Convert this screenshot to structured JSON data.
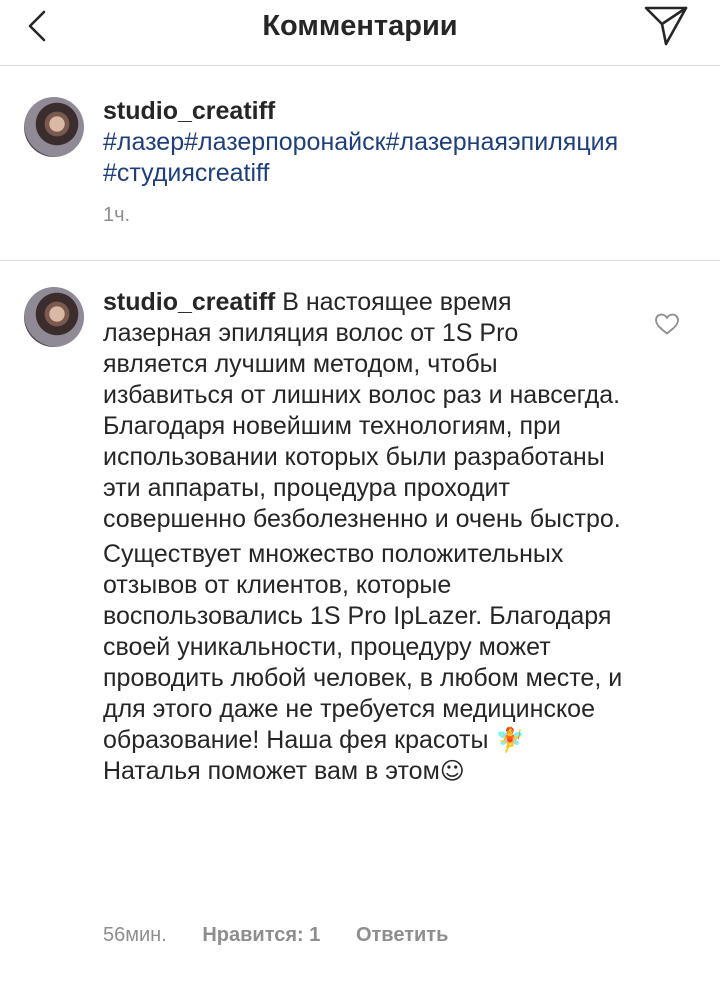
{
  "header": {
    "title": "Комментарии",
    "back_icon": "chevron-left-icon",
    "send_icon": "paper-plane-icon"
  },
  "caption": {
    "username": "studio_creatiff",
    "hashtags": [
      "#лазер",
      "#лазерпоронайск",
      "#лазернаяэпиляция",
      "#студияcreatiff"
    ],
    "time": "1ч."
  },
  "comment": {
    "username": "studio_creatiff",
    "paragraph1": "В настоящее время лазерная эпиляция волос от 1S Pro является лучшим методом, чтобы избавиться от лишних волос раз и навсегда. Благодаря новейшим технологиям, при использовании которых были разработаны эти аппараты, процедура проходит совершенно безболезненно и очень быстро.",
    "paragraph2_a": "Существует множество положительных отзывов от клиентов, которые воспользовались 1S Pro IpLazer. Благодаря своей уникальности, процедуру может проводить любой человек, в любом месте, и для этого даже не требуется медицинское образование! Наша фея красоты ",
    "fairy_emoji": "🧚",
    "paragraph2_b": " Наталья поможет вам в этом",
    "smile_emoji": "☺",
    "time": "56мин.",
    "likes": "Нравится: 1",
    "reply": "Ответить",
    "like_icon": "heart-outline-icon"
  },
  "colors": {
    "text": "#262626",
    "hashtag": "#1f3f78",
    "muted": "#8e8e8e",
    "divider": "#dbdbdb"
  }
}
